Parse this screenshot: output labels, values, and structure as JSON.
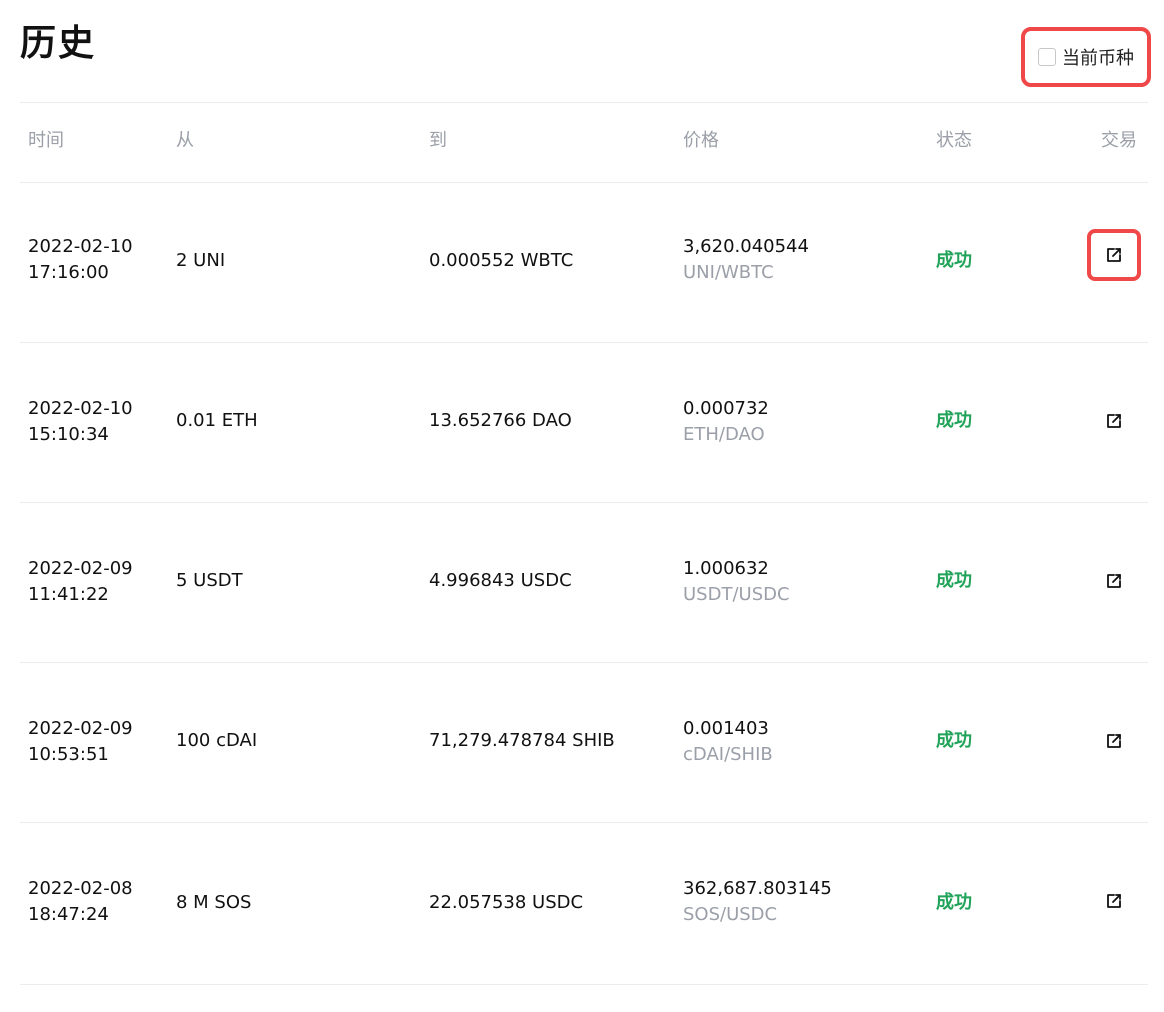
{
  "title": "历史",
  "filter": {
    "label": "当前币种",
    "checked": false
  },
  "columns": {
    "time": "时间",
    "from": "从",
    "to": "到",
    "price": "价格",
    "status": "状态",
    "tx": "交易"
  },
  "rows": [
    {
      "date": "2022-02-10",
      "time": "17:16:00",
      "from": "2 UNI",
      "to": "0.000552 WBTC",
      "price": "3,620.040544",
      "pair": "UNI/WBTC",
      "status": "成功"
    },
    {
      "date": "2022-02-10",
      "time": "15:10:34",
      "from": "0.01 ETH",
      "to": "13.652766 DAO",
      "price": "0.000732",
      "pair": "ETH/DAO",
      "status": "成功"
    },
    {
      "date": "2022-02-09",
      "time": "11:41:22",
      "from": "5 USDT",
      "to": "4.996843 USDC",
      "price": "1.000632",
      "pair": "USDT/USDC",
      "status": "成功"
    },
    {
      "date": "2022-02-09",
      "time": "10:53:51",
      "from": "100 cDAI",
      "to": "71,279.478784 SHIB",
      "price": "0.001403",
      "pair": "cDAI/SHIB",
      "status": "成功"
    },
    {
      "date": "2022-02-08",
      "time": "18:47:24",
      "from": "8 M SOS",
      "to": "22.057538 USDC",
      "price": "362,687.803145",
      "pair": "SOS/USDC",
      "status": "成功"
    }
  ],
  "icons": {
    "tx": "external-link-icon"
  },
  "colors": {
    "success": "#22a35a",
    "muted": "#9a9fa8",
    "highlight": "#f04848"
  }
}
